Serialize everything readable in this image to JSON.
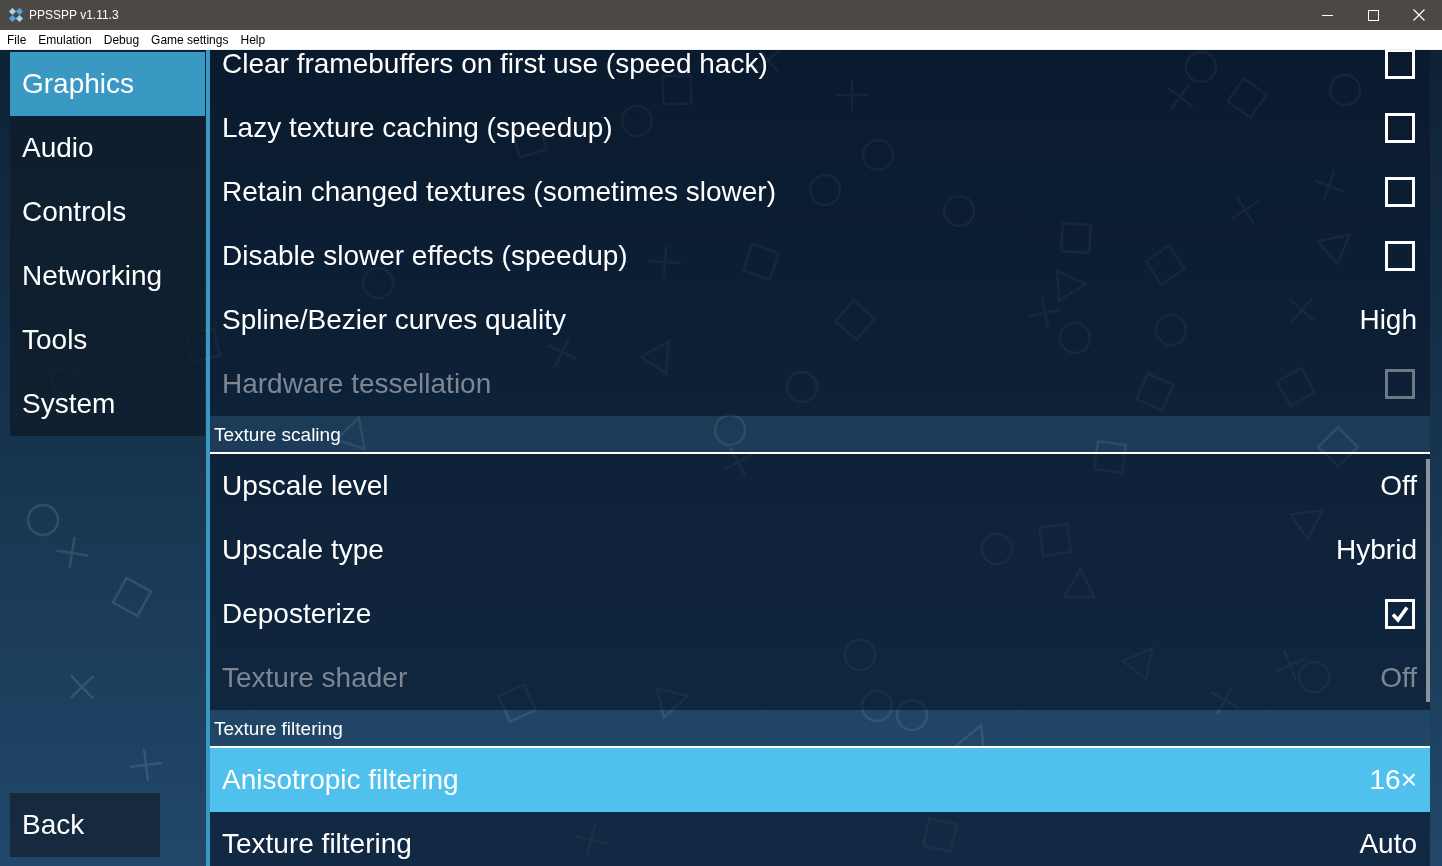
{
  "window": {
    "title": "PPSSPP v1.11.3"
  },
  "menu_bar": [
    "File",
    "Emulation",
    "Debug",
    "Game settings",
    "Help"
  ],
  "sidebar": {
    "tabs": [
      {
        "label": "Graphics",
        "selected": true
      },
      {
        "label": "Audio",
        "selected": false
      },
      {
        "label": "Controls",
        "selected": false
      },
      {
        "label": "Networking",
        "selected": false
      },
      {
        "label": "Tools",
        "selected": false
      },
      {
        "label": "System",
        "selected": false
      }
    ],
    "back_button": "Back"
  },
  "settings": {
    "sections": [
      {
        "items": [
          {
            "kind": "checkbox",
            "label": "Clear framebuffers on first use (speed hack)",
            "checked": false,
            "disabled": false,
            "selected": false
          },
          {
            "kind": "checkbox",
            "label": "Lazy texture caching (speedup)",
            "checked": false,
            "disabled": false,
            "selected": false
          },
          {
            "kind": "checkbox",
            "label": "Retain changed textures (sometimes slower)",
            "checked": false,
            "disabled": false,
            "selected": false
          },
          {
            "kind": "checkbox",
            "label": "Disable slower effects (speedup)",
            "checked": false,
            "disabled": false,
            "selected": false
          },
          {
            "kind": "choice",
            "label": "Spline/Bezier curves quality",
            "value": "High",
            "disabled": false,
            "selected": false
          },
          {
            "kind": "checkbox",
            "label": "Hardware tessellation",
            "checked": false,
            "disabled": true,
            "selected": false
          }
        ]
      },
      {
        "title": "Texture scaling",
        "items": [
          {
            "kind": "choice",
            "label": "Upscale level",
            "value": "Off",
            "disabled": false,
            "selected": false
          },
          {
            "kind": "choice",
            "label": "Upscale type",
            "value": "Hybrid",
            "disabled": false,
            "selected": false
          },
          {
            "kind": "checkbox",
            "label": "Deposterize",
            "checked": true,
            "disabled": false,
            "selected": false
          },
          {
            "kind": "choice",
            "label": "Texture shader",
            "value": "Off",
            "disabled": true,
            "selected": false
          }
        ]
      },
      {
        "title": "Texture filtering",
        "items": [
          {
            "kind": "choice",
            "label": "Anisotropic filtering",
            "value": "16×",
            "disabled": false,
            "selected": true
          },
          {
            "kind": "choice",
            "label": "Texture filtering",
            "value": "Auto",
            "disabled": false,
            "selected": false
          }
        ]
      }
    ]
  }
}
